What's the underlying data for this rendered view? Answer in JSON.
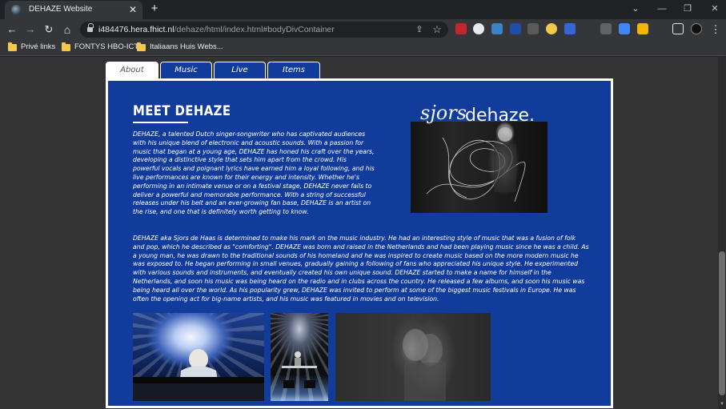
{
  "browser": {
    "tab_title": "DEHAZE Website",
    "tab_close": "✕",
    "new_tab": "+",
    "window_controls": {
      "dropdown": "⌄",
      "minimize": "—",
      "maximize": "❐",
      "close": "✕"
    },
    "nav": {
      "back": "←",
      "forward": "→",
      "reload": "↻",
      "home": "⌂"
    },
    "url_host": "i484476.hera.fhict.nl",
    "url_path": "/dehaze/html/index.html#bodyDivContainer",
    "omnibox_icons": {
      "share": "⇪",
      "bookmark_star": "☆"
    },
    "menu": "⋮",
    "bookmarks": [
      {
        "label": "Privé links"
      },
      {
        "label": "FONTYS HBO-ICT"
      },
      {
        "label": "Italiaans Huis Webs..."
      }
    ]
  },
  "site": {
    "tabs": [
      {
        "label": "About",
        "active": true
      },
      {
        "label": "Music",
        "active": false
      },
      {
        "label": "Live",
        "active": false
      },
      {
        "label": "Items",
        "active": false
      }
    ],
    "heading": "MEET DEHAZE",
    "logo": {
      "script": "sjors",
      "wordmark": "dehaze."
    },
    "paragraph1": "DEHAZE, a talented Dutch singer-songwriter who has captivated audiences with his unique blend of electronic and acoustic sounds. With a passion for music that began at a young age, DEHAZE has honed his craft over the years, developing a distinctive style that sets him apart from the crowd. His powerful vocals and poignant lyrics have earned him a loyal following, and his live performances are known for their energy and intensity. Whether he's performing in an intimate venue or on a festival stage, DEHAZE never fails to deliver a powerful and memorable performance. With a string of successful releases under his belt and an ever-growing fan base, DEHAZE is an artist on the rise, and one that is definitely worth getting to know.",
    "paragraph2": "DEHAZE aka Sjors de Haas is determined to make his mark on the music industry. He had an interesting style of music that was a fusion of folk and pop, which he described as \"comforting\". DEHAZE was born and raised in the Netherlands and had been playing music since he was a child. As a young man, he was drawn to the traditional sounds of his homeland and he was inspired to create music based on the more modern music he was exposed to. He began performing in small venues, gradually gaining a following of fans who appreciated his unique style. He experimented with various sounds and instruments, and eventually created his own unique sound. DEHAZE started to make a name for himself in the Netherlands, and soon his music was being heard on the radio and in clubs across the country. He released a few albums, and soon his music was being heard all over the world. As his popularity grew, DEHAZE was invited to perform at some of the biggest music festivals in Europe. He was often the opening act for big-name artists, and his music was featured in movies and on television."
  },
  "colors": {
    "site_blue": "#123c9c",
    "page_bg": "#333333",
    "chrome_dark": "#202124",
    "chrome_mid": "#35363a"
  }
}
